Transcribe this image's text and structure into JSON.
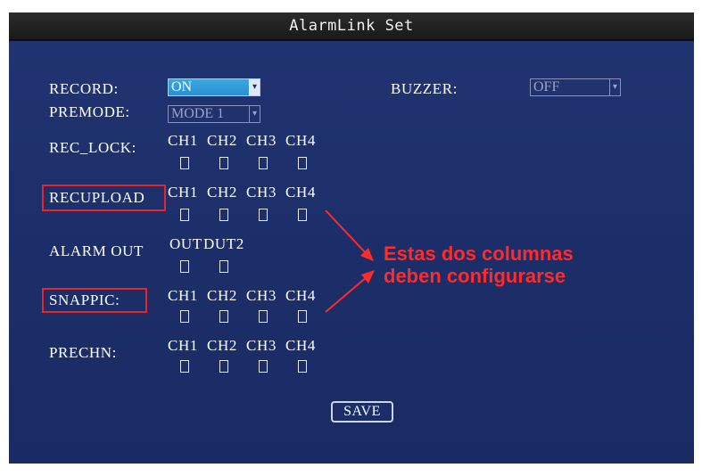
{
  "window": {
    "title": "AlarmLink Set"
  },
  "record": {
    "label": "RECORD:",
    "value": "ON"
  },
  "buzzer": {
    "label": "BUZZER:",
    "value": "OFF"
  },
  "premode": {
    "label": "PREMODE:",
    "value": "MODE 1"
  },
  "rec_lock": {
    "label": "REC_LOCK:",
    "channels": [
      "CH1",
      "CH2",
      "CH3",
      "CH4"
    ]
  },
  "recupload": {
    "label": "RECUPLOAD",
    "channels": [
      "CH1",
      "CH2",
      "CH3",
      "CH4"
    ]
  },
  "alarm_out": {
    "label": "ALARM OUT",
    "outputs": [
      "OUT",
      "DUT2"
    ]
  },
  "snappic": {
    "label": "SNAPPIC:",
    "channels": [
      "CH1",
      "CH2",
      "CH3",
      "CH4"
    ]
  },
  "prechn": {
    "label": "PRECHN:",
    "channels": [
      "CH1",
      "CH2",
      "CH3",
      "CH4"
    ]
  },
  "save_label": "SAVE",
  "annotation": {
    "line1": "Estas dos columnas",
    "line2": "deben configurarse",
    "color": "#ff2a2a"
  },
  "colors": {
    "background": "#1c2e69",
    "titlebar": "#1a1a1a",
    "highlight": "#2a8fd3",
    "annotation_box": "#e5262a"
  }
}
